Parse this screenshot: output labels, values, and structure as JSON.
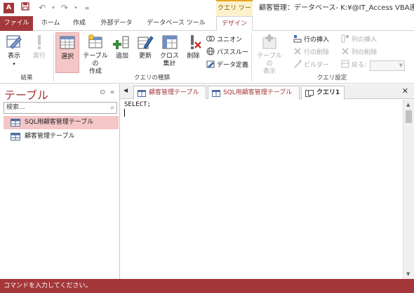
{
  "titlebar": {
    "app_icon": "A",
    "qat_icons": [
      "save-icon",
      "undo-icon",
      "redo-icon",
      "customize-icon"
    ],
    "context_tab_title": "クエリ ツール",
    "window_title": "顧客管理：データベース- K:¥@IT_Access VBA連載"
  },
  "tabs": {
    "file": "ファイル",
    "home": "ホーム",
    "create": "作成",
    "external": "外部データ",
    "dbtools": "データベース ツール",
    "design": "デザイン"
  },
  "ribbon": {
    "results": {
      "view": "表示",
      "run": "実行",
      "label": "結果"
    },
    "query_type": {
      "select": "選択",
      "make_table_1": "テーブルの",
      "make_table_2": "作成",
      "append": "追加",
      "update": "更新",
      "crosstab_1": "クロス",
      "crosstab_2": "集計",
      "delete": "削除",
      "union": "ユニオン",
      "passthrough": "パススルー",
      "data_definition": "データ定義",
      "label": "クエリの種類"
    },
    "query_setup": {
      "show_table_1": "テーブルの",
      "show_table_2": "表示",
      "insert_rows": "行の挿入",
      "delete_rows": "行の削除",
      "builder": "ビルダー",
      "insert_columns": "列の挿入",
      "delete_columns": "列の削除",
      "return": "戻る:",
      "label": "クエリ設定"
    }
  },
  "nav": {
    "title": "テーブル",
    "search_placeholder": "検索...",
    "items": [
      {
        "label": "SQL用顧客管理テーブル",
        "selected": true
      },
      {
        "label": "顧客管理テーブル",
        "selected": false
      }
    ]
  },
  "doc": {
    "tabs": [
      {
        "label": "顧客管理テーブル",
        "icon": "table-icon",
        "active": false
      },
      {
        "label": "SQL用顧客管理テーブル",
        "icon": "table-icon",
        "active": false
      },
      {
        "label": "クエリ1",
        "icon": "query-icon",
        "active": true
      }
    ],
    "sql_text": "SELECT;"
  },
  "status": {
    "text": "コマンドを入力してください。"
  },
  "colors": {
    "accent": "#a4373a",
    "selected_bg": "#f4c6c7",
    "context_tab": "#fdf1cd"
  }
}
